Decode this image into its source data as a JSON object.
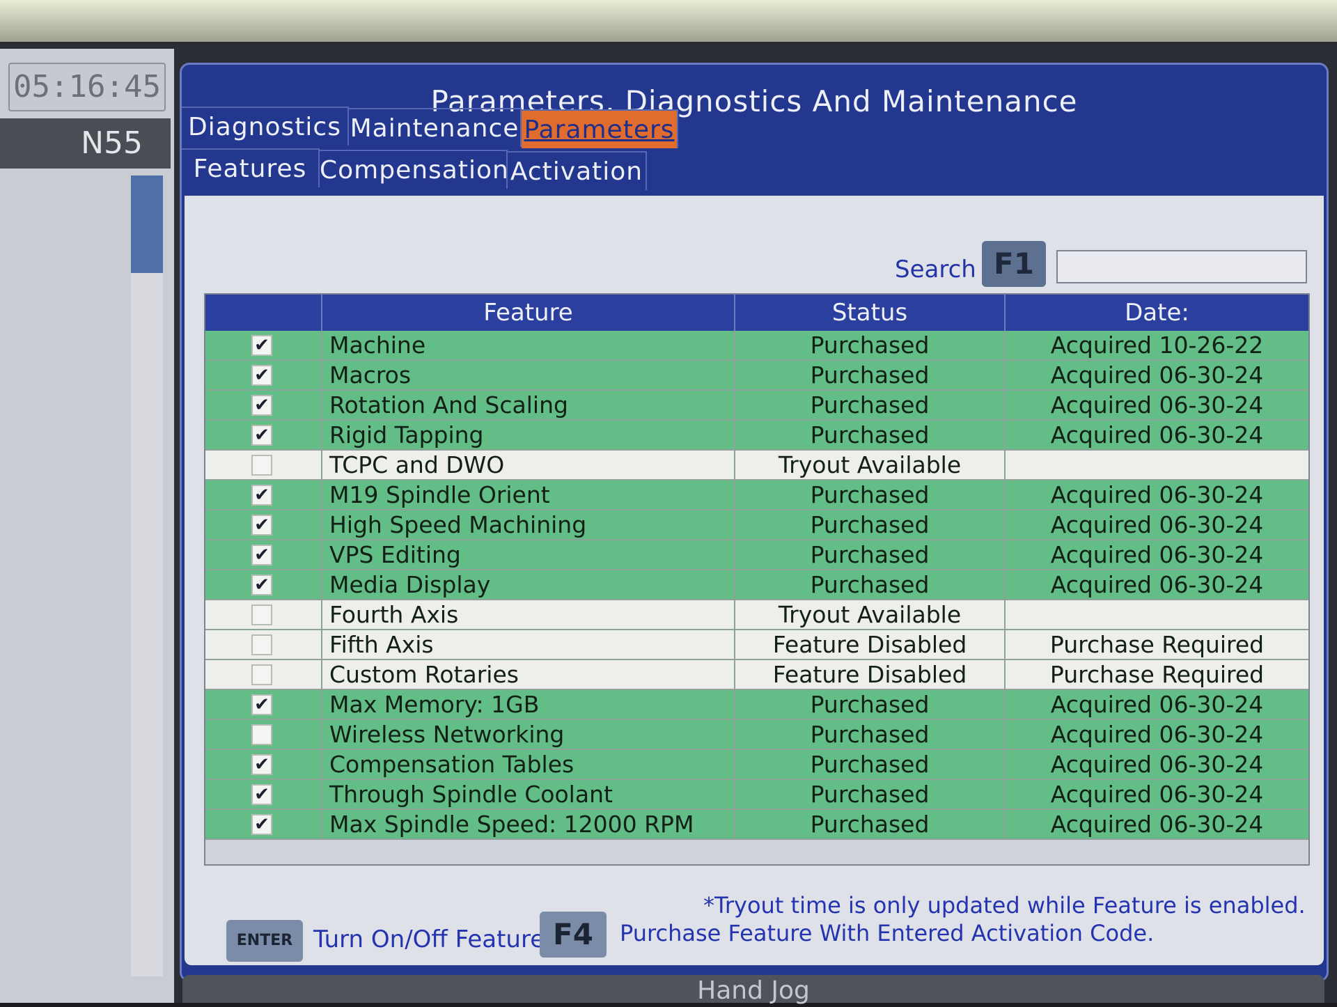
{
  "clock": "05:16:45",
  "n_line": "N55",
  "title": "Parameters, Diagnostics And Maintenance",
  "tabs_top": [
    "Diagnostics",
    "Maintenance",
    "Parameters"
  ],
  "tabs_bottom": [
    "Features",
    "Compensation",
    "Activation"
  ],
  "active_tab": "Parameters",
  "search": {
    "label": "Search",
    "key": "F1",
    "value": ""
  },
  "table": {
    "headers": [
      "",
      "Feature",
      "Status",
      "Date:"
    ],
    "rows": [
      {
        "checked": true,
        "feature": "Machine",
        "status": "Purchased",
        "date": "Acquired 10-26-22",
        "highlight": true
      },
      {
        "checked": true,
        "feature": "Macros",
        "status": "Purchased",
        "date": "Acquired 06-30-24",
        "highlight": true
      },
      {
        "checked": true,
        "feature": "Rotation And Scaling",
        "status": "Purchased",
        "date": "Acquired 06-30-24",
        "highlight": true
      },
      {
        "checked": true,
        "feature": "Rigid Tapping",
        "status": "Purchased",
        "date": "Acquired 06-30-24",
        "highlight": true
      },
      {
        "checked": false,
        "feature": "TCPC and DWO",
        "status": "Tryout Available",
        "date": "",
        "highlight": false
      },
      {
        "checked": true,
        "feature": "M19 Spindle Orient",
        "status": "Purchased",
        "date": "Acquired 06-30-24",
        "highlight": true
      },
      {
        "checked": true,
        "feature": "High Speed Machining",
        "status": "Purchased",
        "date": "Acquired 06-30-24",
        "highlight": true
      },
      {
        "checked": true,
        "feature": "VPS Editing",
        "status": "Purchased",
        "date": "Acquired 06-30-24",
        "highlight": true
      },
      {
        "checked": true,
        "feature": "Media Display",
        "status": "Purchased",
        "date": "Acquired 06-30-24",
        "highlight": true
      },
      {
        "checked": false,
        "feature": "Fourth Axis",
        "status": "Tryout Available",
        "date": "",
        "highlight": false
      },
      {
        "checked": false,
        "feature": "Fifth Axis",
        "status": "Feature Disabled",
        "date": "Purchase Required",
        "highlight": false
      },
      {
        "checked": false,
        "feature": "Custom Rotaries",
        "status": "Feature Disabled",
        "date": "Purchase Required",
        "highlight": false
      },
      {
        "checked": true,
        "feature": "Max Memory: 1GB",
        "status": "Purchased",
        "date": "Acquired 06-30-24",
        "highlight": true
      },
      {
        "checked": false,
        "feature": "Wireless Networking",
        "status": "Purchased",
        "date": "Acquired 06-30-24",
        "highlight": true
      },
      {
        "checked": true,
        "feature": "Compensation Tables",
        "status": "Purchased",
        "date": "Acquired 06-30-24",
        "highlight": true
      },
      {
        "checked": true,
        "feature": "Through Spindle Coolant",
        "status": "Purchased",
        "date": "Acquired 06-30-24",
        "highlight": true
      },
      {
        "checked": true,
        "feature": "Max Spindle Speed: 12000 RPM",
        "status": "Purchased",
        "date": "Acquired 06-30-24",
        "highlight": true
      }
    ]
  },
  "note": "*Tryout time is only updated while Feature is enabled.",
  "actions": {
    "enter_key": "ENTER",
    "enter_label": "Turn On/Off Feature",
    "f4_key": "F4",
    "f4_label": "Purchase Feature With Entered Activation Code."
  },
  "bottom_bar": "Hand Jog",
  "colors": {
    "panel": "#23378f",
    "active_tab": "#e06d2d",
    "row_enabled": "#62bd87",
    "row_disabled": "#eeeeea",
    "link_text": "#2434b0"
  }
}
